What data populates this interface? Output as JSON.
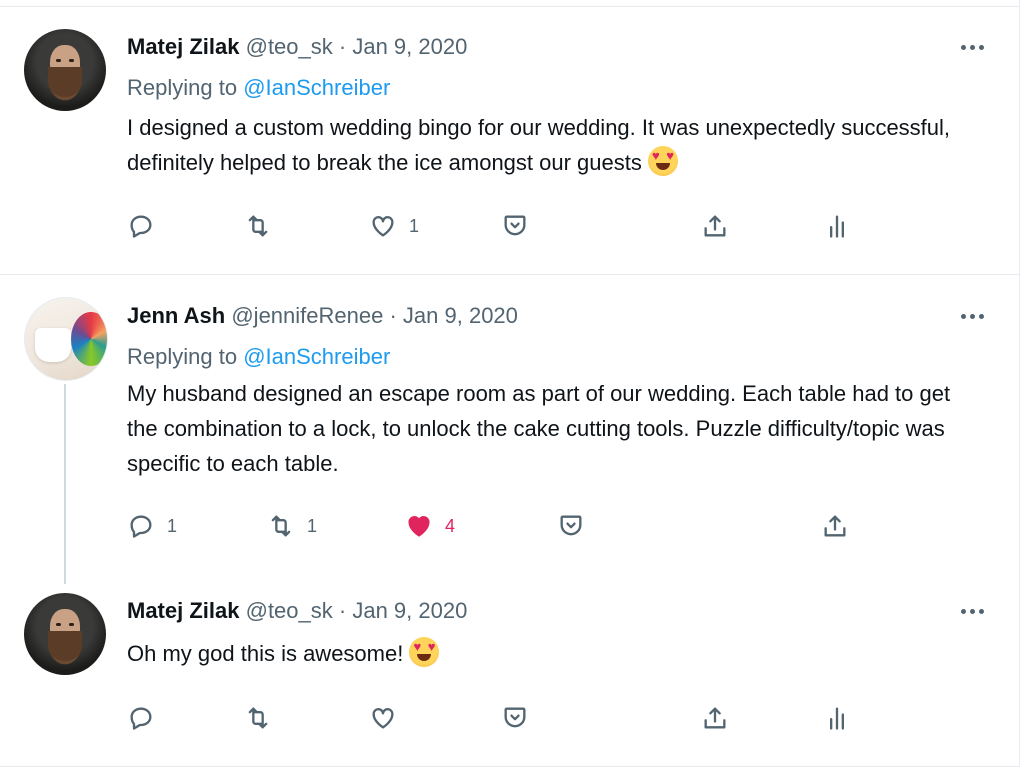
{
  "colors": {
    "accent": "#1d9bf0",
    "like": "#e0245e",
    "secondary_text": "#536471",
    "divider": "#e6ecf0"
  },
  "tweets": [
    {
      "name": "Matej Zilak",
      "handle": "@teo_sk",
      "separator": "·",
      "date": "Jan 9, 2020",
      "replying_prefix": "Replying to",
      "replying_to": "@IanSchreiber",
      "text": "I designed a custom wedding bingo for our wedding. It was unexpectedly successful, definitely helped to break the ice amongst our guests",
      "emoji": "smiling-face-with-heart-eyes",
      "reply_count": "",
      "retweet_count": "",
      "like_count": "1",
      "liked": false
    },
    {
      "name": "Jenn Ash",
      "handle": "@jennifeRenee",
      "separator": "·",
      "date": "Jan 9, 2020",
      "replying_prefix": "Replying to",
      "replying_to": "@IanSchreiber",
      "text": "My husband designed an escape room as part of our wedding. Each table had to get the combination to a lock, to unlock the cake cutting tools. Puzzle difficulty/topic was specific to each table.",
      "reply_count": "1",
      "retweet_count": "1",
      "like_count": "4",
      "liked": true
    },
    {
      "name": "Matej Zilak",
      "handle": "@teo_sk",
      "separator": "·",
      "date": "Jan 9, 2020",
      "text": "Oh my god this is awesome!",
      "emoji": "smiling-face-with-heart-eyes",
      "reply_count": "",
      "retweet_count": "",
      "like_count": "",
      "liked": false
    }
  ],
  "icons": [
    "reply-icon",
    "retweet-icon",
    "like-icon",
    "tip-icon",
    "share-icon",
    "analytics-icon",
    "more-icon"
  ]
}
